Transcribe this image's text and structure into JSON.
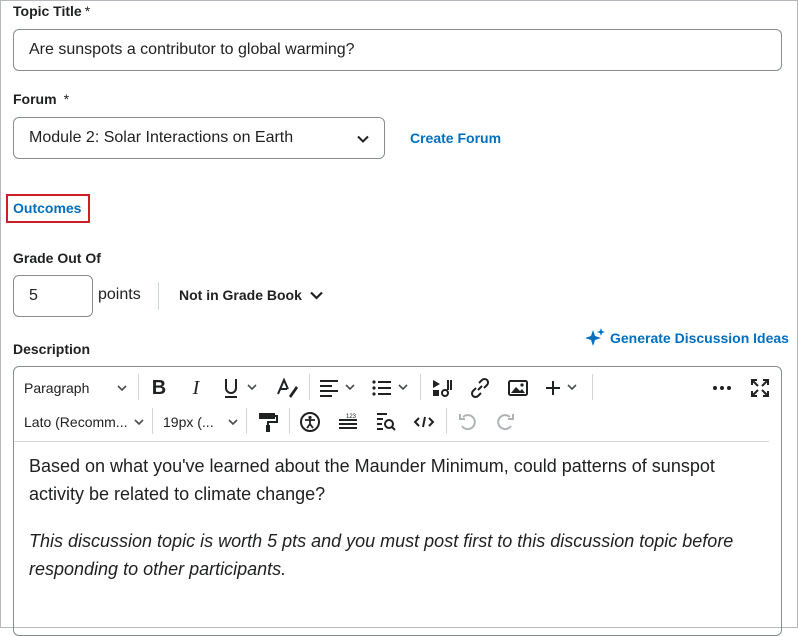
{
  "topic": {
    "label": "Topic Title",
    "required": "*",
    "value": "Are sunspots a contributor to global warming?"
  },
  "forum": {
    "label": "Forum",
    "required": "*",
    "selected": "Module 2: Solar Interactions on Earth",
    "create_link": "Create Forum"
  },
  "outcomes": {
    "label": "Outcomes"
  },
  "grade": {
    "label": "Grade Out Of",
    "value": "5",
    "unit": "points",
    "gradebook": "Not in Grade Book"
  },
  "description": {
    "label": "Description",
    "generate": "Generate Discussion Ideas"
  },
  "toolbar": {
    "paragraph": "Paragraph",
    "font": "Lato (Recomm...",
    "size": "19px (..."
  },
  "editor": {
    "para1": "Based on what you've learned about the Maunder Minimum, could patterns of sunspot activity be related to climate change?",
    "para2": "This discussion topic is worth 5 pts and you must post first to this discussion topic before responding to other participants."
  },
  "colors": {
    "link": "#006fbf",
    "outcomes_border": "#cd2026"
  }
}
